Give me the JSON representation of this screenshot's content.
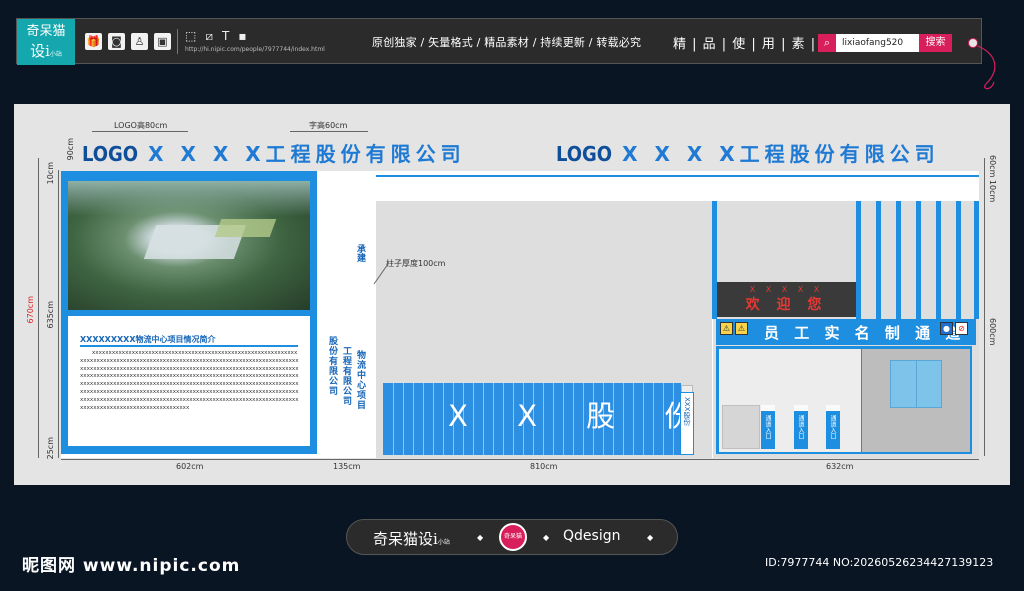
{
  "header": {
    "brand_line1": "奇呆猫",
    "brand_line2": "设i",
    "brand_small": "小站",
    "tool_icons": [
      "gift-icon",
      "camera-icon",
      "figure-icon",
      "image-icon"
    ],
    "edit_icons": [
      "square-icon",
      "crop-icon",
      "text-icon",
      "block-icon"
    ],
    "edit_glyphs": [
      "⬚",
      "⧄",
      "T",
      "▪"
    ],
    "url": "http://hi.nipic.com/people/7977744/index.html",
    "slogan": "原创独家 / 矢量格式 / 精品素材 / 持续更新 / 转载必究",
    "tagline": "精 | 品 | 使 | 用 | 素 | 材",
    "search_value": "lixiaofang520",
    "search_button": "搜索"
  },
  "drawing": {
    "ann_logo": "LOGO高80cm",
    "ann_char": "字高60cm",
    "dim_90": "90cm",
    "dim_10": "10cm",
    "dim_670": "670cm",
    "dim_635": "635cm",
    "dim_25": "25cm",
    "dim_right_60_10": "60cm 10cm",
    "dim_right_600": "600cm",
    "dim_602": "602cm",
    "dim_135": "135cm",
    "dim_810": "810cm",
    "dim_632": "632cm",
    "column_note": "柱子厚度100cm",
    "logo_text": "LOGO",
    "company_name": "X X X X工程股份有限公司",
    "intro_title": "XXXXXXXXX物流中心项目情况简介",
    "intro_body": "xxxxxxxxxxxxxxxxxxxxxxxxxxxxxxxxxxxxxxxxxxxxxxxxxxxxxxxxxxxxxxxxxxxxxxxxxxxxxxxxxxxxxxxxxxxxxxxxxxxxxxxxxxxxxxxxxxxxxxxxxxxxxxxxxxxxxxxxxxxxxxxxxxxxxxxxxxxxxxxxxxxxxxxxxxxxxxxxxxxxxxxxxxxxxxxxxxxxxxxxxxxxxxxxxxxxxxxxxxxxxxxxxxxxxxxxxxxxxxxxxxxxxxxxxxxxxxxxxxxxxxxxxxxxxxxxxxxxxxxxxxxxxxxxxxxxxxxxxxxxxxxxxxxxxxxxxxxxxxxxxxxxxxxxxxxxxxxxxxxxxxxxxxxxxxxxxxxxxxxxxxxxxxxxxxxxxxxxxxxxxxxxxxxxxxxxxxxxxxxxxxxxxxxxxxxxxxxxxxxxxxxxxxxxxxxxxxxxxxxxxxxxxxxxxxxxxxxxxxxxxxxxxxxxxxxxxxxxxxxxxxxxxxxxxxx",
    "cheng_jian": "承建",
    "side_col1": "股份有限公司",
    "side_col2": "工程有限公司",
    "side_col3": "物流中心项目",
    "fence_text": "X X 股 份",
    "fence_post": "XXX股份",
    "welcome_xx": "X X X X X",
    "welcome": "欢 迎 您",
    "realname": "员 工 实 名 制 通 道",
    "gate_label": "通道入口"
  },
  "footer": {
    "name": "奇呆猫设i",
    "name_small": "小站",
    "emblem": "奇呆猫",
    "design": "Qdesign",
    "site": "昵图网 www.nipic.com",
    "doc_id": "ID:7977744 NO:20260526234427139123"
  },
  "colors": {
    "brand_teal": "#14a7ad",
    "accent_pink": "#d81e5b",
    "board_blue": "#1e8ee0",
    "title_blue": "#1f7ad3"
  }
}
